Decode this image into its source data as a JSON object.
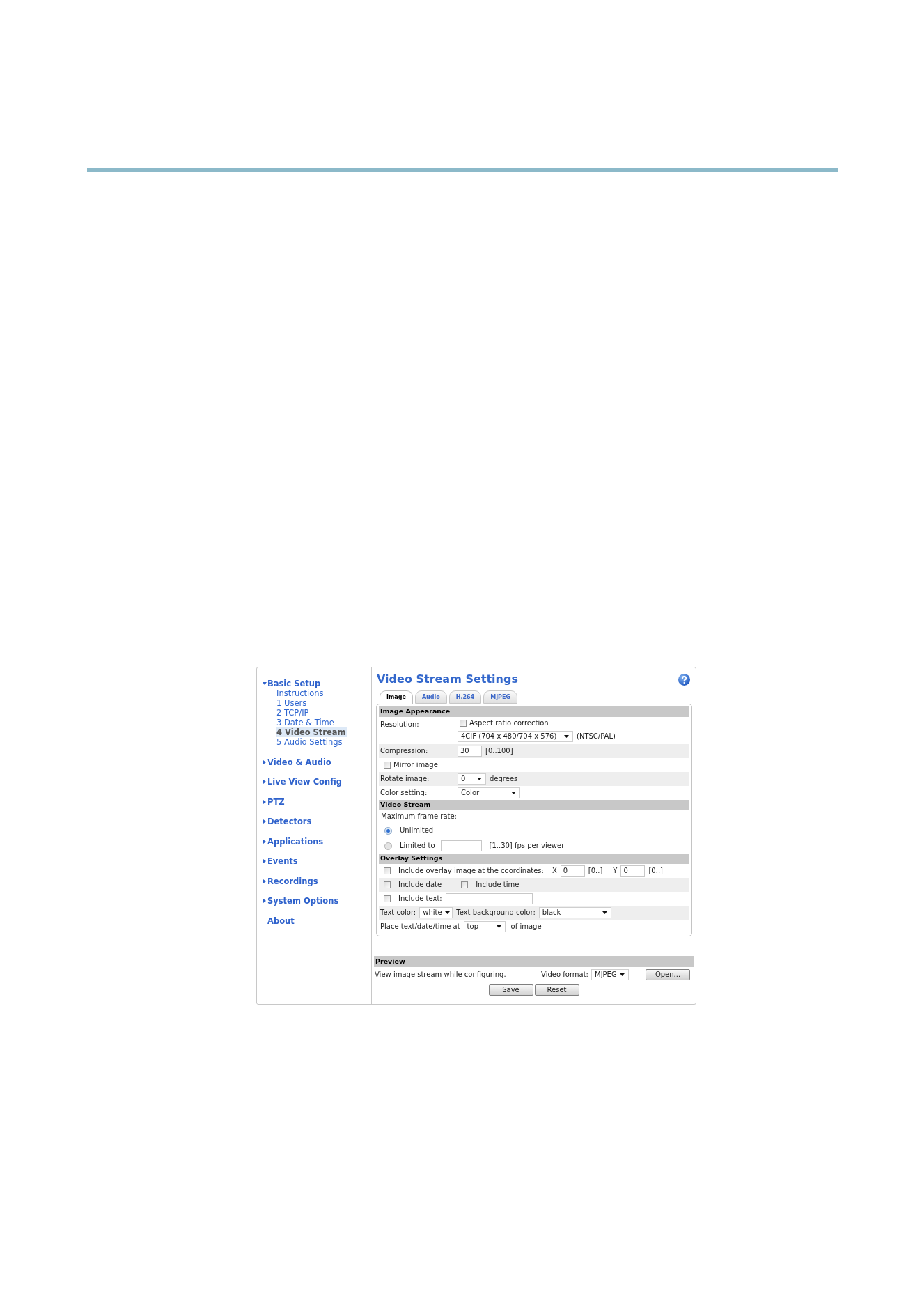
{
  "sidebar": {
    "items": [
      {
        "label": "Basic Setup",
        "kind": "group",
        "expanded": true,
        "children": [
          {
            "label": "Instructions",
            "selected": false
          },
          {
            "label": "1 Users",
            "selected": false
          },
          {
            "label": "2 TCP/IP",
            "selected": false
          },
          {
            "label": "3 Date & Time",
            "selected": false
          },
          {
            "label": "4 Video Stream",
            "selected": true
          },
          {
            "label": "5 Audio Settings",
            "selected": false
          }
        ]
      },
      {
        "label": "Video & Audio",
        "kind": "group",
        "expanded": false
      },
      {
        "label": "Live View Config",
        "kind": "group",
        "expanded": false
      },
      {
        "label": "PTZ",
        "kind": "group",
        "expanded": false
      },
      {
        "label": "Detectors",
        "kind": "group",
        "expanded": false
      },
      {
        "label": "Applications",
        "kind": "group",
        "expanded": false
      },
      {
        "label": "Events",
        "kind": "group",
        "expanded": false
      },
      {
        "label": "Recordings",
        "kind": "group",
        "expanded": false
      },
      {
        "label": "System Options",
        "kind": "group",
        "expanded": false
      },
      {
        "label": "About",
        "kind": "link"
      }
    ]
  },
  "title": "Video Stream Settings",
  "tabs": [
    {
      "label": "Image",
      "selected": true
    },
    {
      "label": "Audio",
      "selected": false
    },
    {
      "label": "H.264",
      "selected": false
    },
    {
      "label": "MJPEG",
      "selected": false
    }
  ],
  "sections": [
    {
      "title": "Image Appearance",
      "rows": [
        {
          "label": "Resolution:",
          "lines": [
            [
              {
                "kind": "checkbox",
                "label": "Aspect ratio correction",
                "checked": false
              }
            ],
            [
              {
                "kind": "select",
                "value": "4CIF (704 x 480/704 x 576)"
              },
              {
                "kind": "text",
                "text": "(NTSC/PAL)"
              }
            ]
          ]
        },
        {
          "label": "Compression:",
          "lines": [
            [
              {
                "kind": "input",
                "value": "30"
              },
              {
                "kind": "text",
                "text": "[0..100]"
              }
            ]
          ]
        },
        {
          "lines": [
            [
              {
                "kind": "checkbox",
                "label": "Mirror image",
                "checked": false
              }
            ]
          ]
        },
        {
          "label": "Rotate image:",
          "lines": [
            [
              {
                "kind": "select",
                "value": "0"
              },
              {
                "kind": "text",
                "text": "degrees"
              }
            ]
          ]
        },
        {
          "label": "Color setting:",
          "lines": [
            [
              {
                "kind": "select",
                "value": "Color"
              }
            ]
          ]
        }
      ]
    },
    {
      "title": "Video Stream",
      "rows": [
        {
          "lines": [
            [
              {
                "kind": "text",
                "text": "Maximum frame rate:"
              }
            ],
            [
              {
                "kind": "radio",
                "label": "Unlimited",
                "selected": true
              }
            ],
            [
              {
                "kind": "radio",
                "label": "Limited to",
                "selected": false
              },
              {
                "kind": "input"
              },
              {
                "kind": "text",
                "text": "[1..30] fps per viewer"
              }
            ]
          ]
        }
      ]
    },
    {
      "title": "Overlay Settings",
      "rows": [
        {
          "lines": [
            [
              {
                "kind": "checkbox",
                "label": "Include overlay image at the coordinates:",
                "checked": false
              },
              {
                "kind": "text",
                "text": "X"
              },
              {
                "kind": "input",
                "value": "0"
              },
              {
                "kind": "text",
                "text": "[0..]"
              },
              {
                "kind": "text",
                "text": "Y"
              },
              {
                "kind": "input",
                "value": "0"
              },
              {
                "kind": "text",
                "text": "[0..]"
              }
            ]
          ]
        },
        {
          "lines": [
            [
              {
                "kind": "checkbox",
                "label": "Include date",
                "checked": false
              },
              {
                "kind": "checkbox",
                "label": "Include time",
                "checked": false
              }
            ]
          ]
        },
        {
          "lines": [
            [
              {
                "kind": "checkbox",
                "label": "Include text:",
                "checked": false
              },
              {
                "kind": "input"
              }
            ]
          ]
        },
        {
          "lines": [
            [
              {
                "kind": "text",
                "text": "Text color:"
              },
              {
                "kind": "select",
                "value": "white"
              },
              {
                "kind": "text",
                "text": "Text background color:"
              },
              {
                "kind": "select",
                "value": "black"
              }
            ]
          ]
        },
        {
          "lines": [
            [
              {
                "kind": "text",
                "text": "Place text/date/time at"
              },
              {
                "kind": "select",
                "value": "top"
              },
              {
                "kind": "text",
                "text": "of image"
              }
            ]
          ]
        }
      ]
    }
  ],
  "preview": {
    "title": "Preview",
    "description": "View image stream while configuring.",
    "format_label": "Video format:",
    "format": "MJPEG",
    "open_button": "Open..."
  },
  "buttons": [
    "Save",
    "Reset"
  ]
}
